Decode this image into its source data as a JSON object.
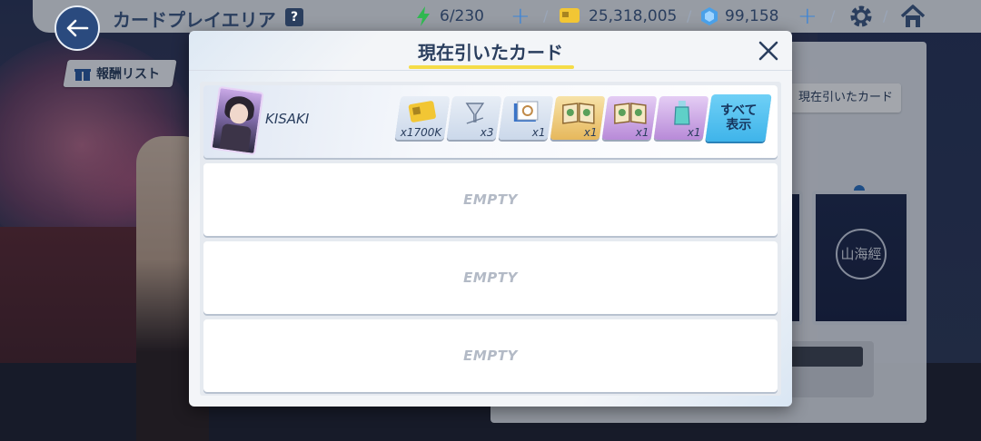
{
  "header": {
    "title": "カードプレイエリア",
    "help": "?",
    "stamina": "6/230",
    "credits": "25,318,005",
    "gems": "99,158"
  },
  "reward_list_label": "報酬リスト",
  "side_panel": {
    "tab_label": "現在引いたカード",
    "card_seal": "山海經"
  },
  "modal": {
    "title": "現在引いたカード",
    "rows": [
      {
        "name": "KISAKI",
        "items": [
          {
            "icon": "credit-card-icon",
            "count": "x1700K"
          },
          {
            "icon": "flask-icon",
            "count": "x3"
          },
          {
            "icon": "watch-report-icon",
            "count": "x1"
          },
          {
            "icon": "book-gold-icon",
            "count": "x1"
          },
          {
            "icon": "book-purple-icon",
            "count": "x1"
          },
          {
            "icon": "potion-icon",
            "count": "x1"
          }
        ],
        "show_all_label": "すべて表示"
      }
    ],
    "empty_label": "EMPTY"
  },
  "colors": {
    "accent_blue": "#3fb4ea",
    "title_underline": "#f5dc48",
    "text_dark": "#2a3e5e"
  }
}
